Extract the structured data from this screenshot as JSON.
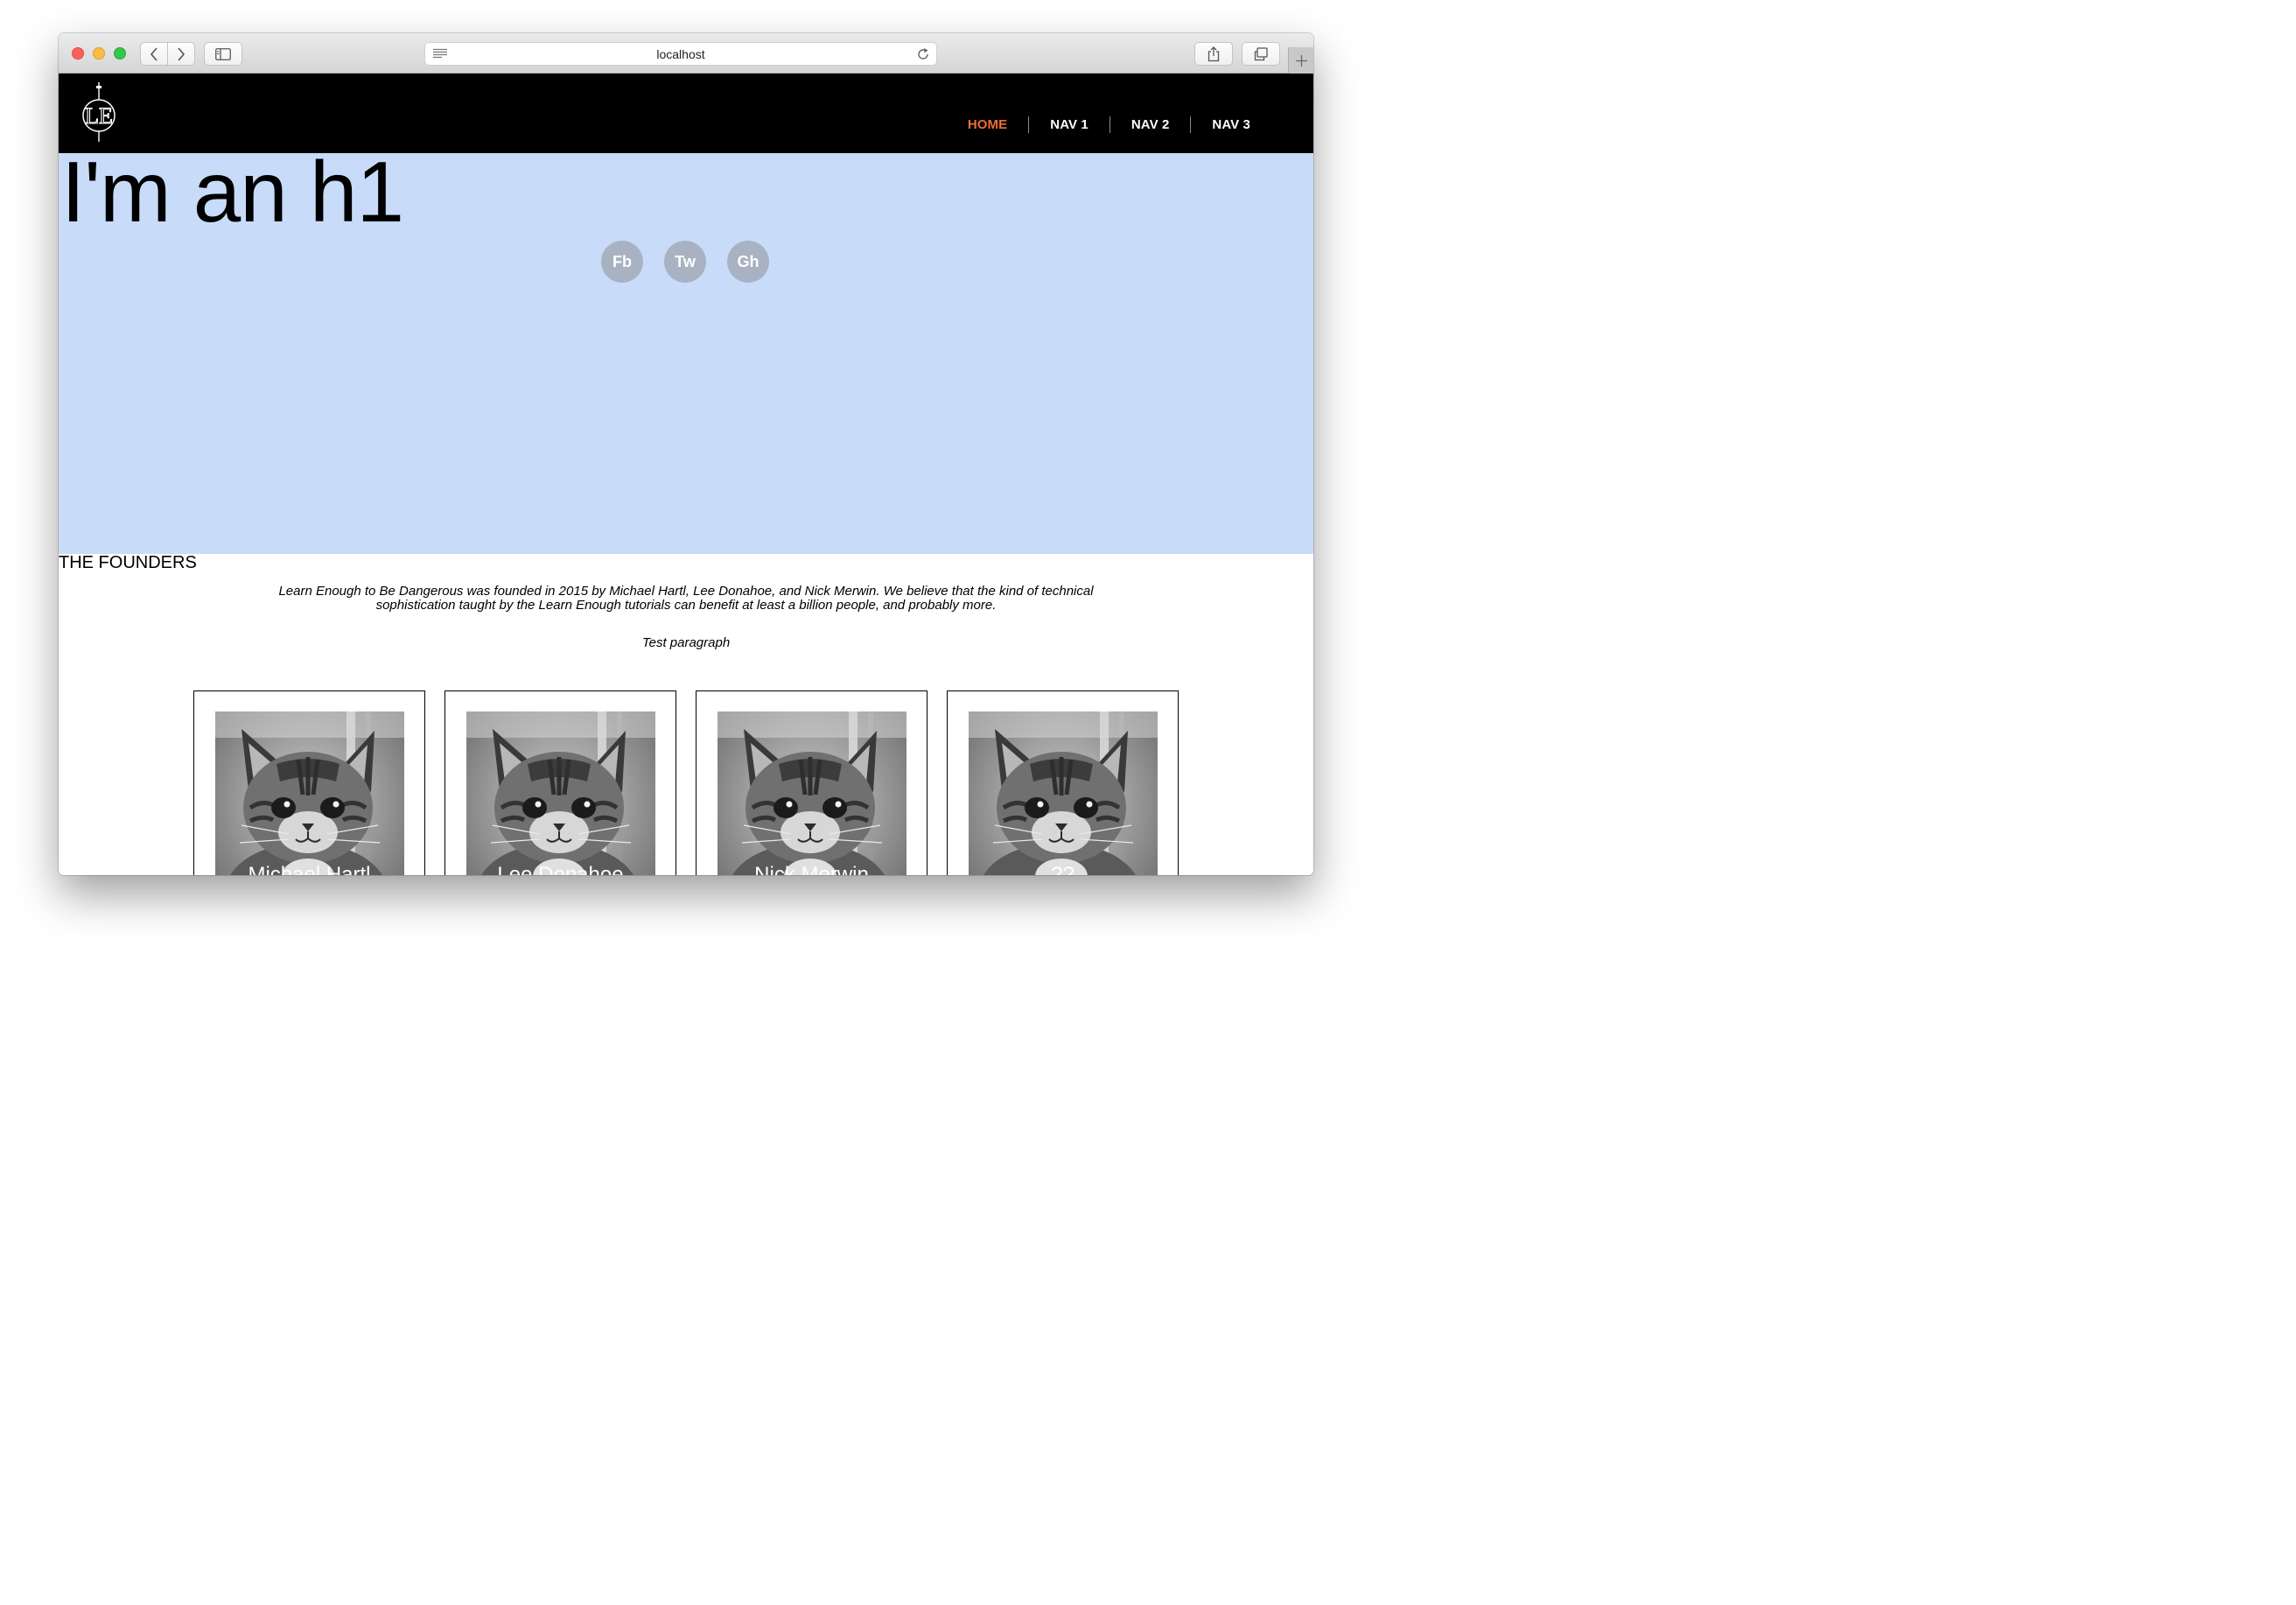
{
  "browser": {
    "url": "localhost"
  },
  "site": {
    "logo_text": "LE",
    "nav": [
      {
        "label": "HOME",
        "active": true
      },
      {
        "label": "NAV 1",
        "active": false
      },
      {
        "label": "NAV 2",
        "active": false
      },
      {
        "label": "NAV 3",
        "active": false
      }
    ],
    "active_color": "#ed6e2f"
  },
  "hero": {
    "title": "I'm an h1",
    "background": "#c8dcf9",
    "social": [
      {
        "label": "Fb"
      },
      {
        "label": "Tw"
      },
      {
        "label": "Gh"
      }
    ]
  },
  "founders": {
    "heading": "THE FOUNDERS",
    "intro": "Learn Enough to Be Dangerous was founded in 2015 by Michael Hartl, Lee Donahoe, and Nick Merwin. We believe that the kind of technical sophistication taught by the Learn Enough tutorials can benefit at least a billion people, and probably more.",
    "test_paragraph": "Test paragraph",
    "cards": [
      {
        "name": "Michael Hartl",
        "photo": "kitten-photo"
      },
      {
        "name": "Lee Donahoe",
        "photo": "kitten-photo"
      },
      {
        "name": "Nick Merwin",
        "photo": "kitten-photo"
      },
      {
        "name": "??",
        "photo": "kitten-photo"
      }
    ]
  }
}
